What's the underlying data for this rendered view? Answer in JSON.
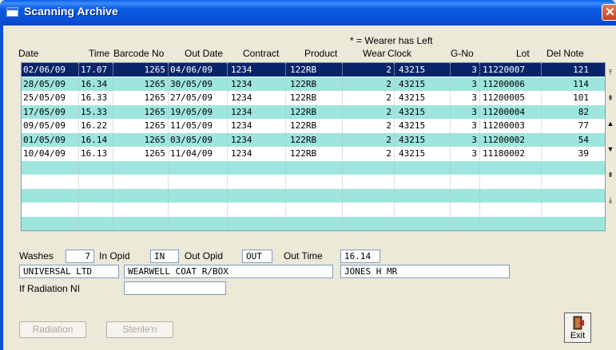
{
  "window": {
    "title": "Scanning Archive",
    "close_glyph": "✕"
  },
  "legend_note": "* = Wearer has Left",
  "columns": {
    "date": "Date",
    "time": "Time",
    "barcode": "Barcode No",
    "out_date": "Out Date",
    "contract": "Contract",
    "product": "Product",
    "wear": "Wear",
    "clock": "Clock",
    "gno": "G-No",
    "lot": "Lot",
    "del_note": "Del Note"
  },
  "rows": [
    {
      "date": "02/06/09",
      "time": "17.07",
      "barcode": "1265",
      "out_date": "04/06/09",
      "contract": "1234",
      "product": "122RB",
      "wear": "2",
      "clock": "43215",
      "gno": "3",
      "lot": "11220007",
      "del_note": "121"
    },
    {
      "date": "28/05/09",
      "time": "16.34",
      "barcode": "1265",
      "out_date": "30/05/09",
      "contract": "1234",
      "product": "122RB",
      "wear": "2",
      "clock": "43215",
      "gno": "3",
      "lot": "11200006",
      "del_note": "114"
    },
    {
      "date": "25/05/09",
      "time": "16.33",
      "barcode": "1265",
      "out_date": "27/05/09",
      "contract": "1234",
      "product": "122RB",
      "wear": "2",
      "clock": "43215",
      "gno": "3",
      "lot": "11200005",
      "del_note": "101"
    },
    {
      "date": "17/05/09",
      "time": "15.33",
      "barcode": "1265",
      "out_date": "19/05/09",
      "contract": "1234",
      "product": "122RB",
      "wear": "2",
      "clock": "43215",
      "gno": "3",
      "lot": "11200004",
      "del_note": "82"
    },
    {
      "date": "09/05/09",
      "time": "16.22",
      "barcode": "1265",
      "out_date": "11/05/09",
      "contract": "1234",
      "product": "122RB",
      "wear": "2",
      "clock": "43215",
      "gno": "3",
      "lot": "11200003",
      "del_note": "77"
    },
    {
      "date": "01/05/09",
      "time": "16.14",
      "barcode": "1265",
      "out_date": "03/05/09",
      "contract": "1234",
      "product": "122RB",
      "wear": "2",
      "clock": "43215",
      "gno": "3",
      "lot": "11200002",
      "del_note": "54"
    },
    {
      "date": "10/04/09",
      "time": "16.13",
      "barcode": "1265",
      "out_date": "11/04/09",
      "contract": "1234",
      "product": "122RB",
      "wear": "2",
      "clock": "43215",
      "gno": "3",
      "lot": "11180002",
      "del_note": "39"
    }
  ],
  "details": {
    "washes_label": "Washes",
    "washes_value": "7",
    "in_opid_label": "In Opid",
    "in_opid_value": "IN",
    "out_opid_label": "Out Opid",
    "out_opid_value": "OUT",
    "out_time_label": "Out Time",
    "out_time_value": "16.14",
    "customer_value": "UNIVERSAL LTD",
    "item_value": "WEARWELL COAT R/BOX",
    "wearer_value": "JONES H MR",
    "radiation_label": "If Radiation NI",
    "radiation_value": ""
  },
  "buttons": {
    "radiation": "Radiation",
    "sterile": "Sterile'n",
    "exit": "Exit"
  },
  "scroll_glyphs": [
    "⤒",
    "⇞",
    "▲",
    "▼",
    "⇟",
    "⤓"
  ],
  "colors": {
    "selected_row": "#0a246a",
    "alt_row": "#9ee5de",
    "titlebar": "#0a50d8"
  }
}
